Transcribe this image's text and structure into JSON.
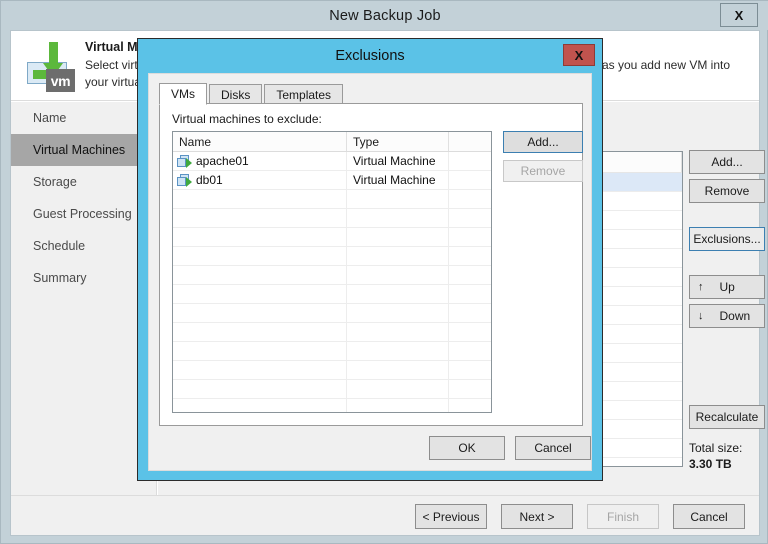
{
  "window": {
    "title": "New Backup Job",
    "close_label": "X"
  },
  "header": {
    "title": "Virtual Machines",
    "description": "Select virtual machines to process via container, or granular selection that automatically changes as you add new VM into your virtual environment.",
    "icon": "vm-download-icon",
    "badge_text": "vm"
  },
  "sidebar": {
    "items": [
      {
        "label": "Name",
        "active": false
      },
      {
        "label": "Virtual Machines",
        "active": true
      },
      {
        "label": "Storage",
        "active": false
      },
      {
        "label": "Guest Processing",
        "active": false
      },
      {
        "label": "Schedule",
        "active": false
      },
      {
        "label": "Summary",
        "active": false
      }
    ]
  },
  "content": {
    "buttons": {
      "add": "Add...",
      "remove": "Remove",
      "exclusions": "Exclusions...",
      "up": "Up",
      "down": "Down",
      "recalculate": "Recalculate"
    },
    "up_glyph": "↑",
    "down_glyph": "↓",
    "total_size_label": "Total size:",
    "total_size_value": "3.30 TB"
  },
  "footer": {
    "previous": "< Previous",
    "next": "Next >",
    "finish": "Finish",
    "cancel": "Cancel"
  },
  "dialog": {
    "title": "Exclusions",
    "close_label": "X",
    "tabs": [
      {
        "label": "VMs",
        "active": true
      },
      {
        "label": "Disks",
        "active": false
      },
      {
        "label": "Templates",
        "active": false
      }
    ],
    "pane_label": "Virtual machines to exclude:",
    "columns": [
      "Name",
      "Type",
      ""
    ],
    "rows": [
      {
        "name": "apache01",
        "type": "Virtual Machine",
        "extra": "",
        "icon": "virtual-machine-icon"
      },
      {
        "name": "db01",
        "type": "Virtual Machine",
        "extra": "",
        "icon": "virtual-machine-icon"
      }
    ],
    "buttons": {
      "add": "Add...",
      "remove": "Remove"
    },
    "ok": "OK",
    "cancel": "Cancel"
  },
  "colors": {
    "dialog_accent": "#5bc2e7",
    "titlebar": "#c3d1d8",
    "close_red": "#c0534e",
    "nav_active": "#a6a6a6",
    "focus_blue": "#3c7fb1"
  }
}
